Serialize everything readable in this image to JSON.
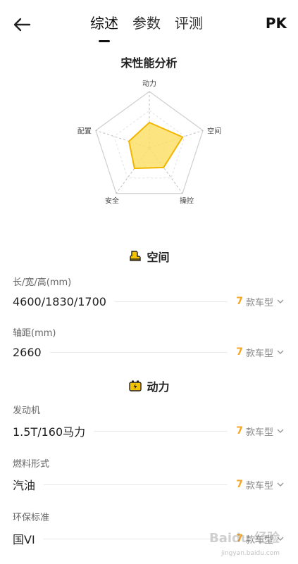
{
  "nav": {
    "tabs": [
      "综述",
      "参数",
      "评测"
    ],
    "pk": "PK"
  },
  "analysis": {
    "title": "宋性能分析",
    "axes": [
      "动力",
      "空间",
      "操控",
      "安全",
      "配置"
    ]
  },
  "chart_data": {
    "type": "radar",
    "title": "宋性能分析",
    "axes": [
      "动力",
      "空间",
      "操控",
      "安全",
      "配置"
    ],
    "values": [
      0.45,
      0.62,
      0.43,
      0.45,
      0.38
    ],
    "range": [
      0,
      1
    ],
    "fill_color": "#fce06b",
    "stroke_color": "#f2b600"
  },
  "sections": [
    {
      "title": "空间",
      "icon": "seat-icon",
      "params": [
        {
          "label": "长/宽/高(mm)",
          "value": "4600/1830/1700",
          "count": "7",
          "suffix": "款车型"
        },
        {
          "label": "轴距(mm)",
          "value": "2660",
          "count": "7",
          "suffix": "款车型"
        }
      ]
    },
    {
      "title": "动力",
      "icon": "battery-icon",
      "params": [
        {
          "label": "发动机",
          "value": "1.5T/160马力",
          "count": "7",
          "suffix": "款车型"
        },
        {
          "label": "燃料形式",
          "value": "汽油",
          "count": "7",
          "suffix": "款车型"
        },
        {
          "label": "环保标准",
          "value": "国VI",
          "count": "7",
          "suffix": "款车型"
        }
      ]
    }
  ],
  "watermark": {
    "text": "Baidu 经验",
    "sub": "jingyan.baidu.com"
  },
  "colors": {
    "accent": "#f5a623",
    "icon": "#f3c200"
  }
}
